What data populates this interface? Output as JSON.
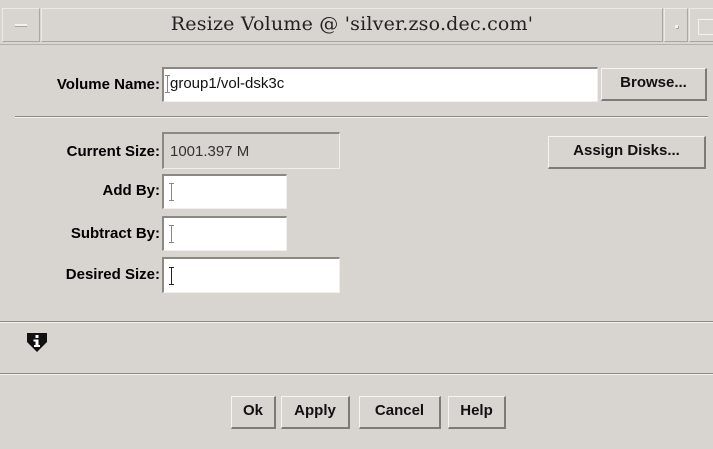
{
  "window": {
    "title": "Resize Volume @ 'silver.zso.dec.com'"
  },
  "volume": {
    "name_label": "Volume Name:",
    "name_value": "group1/vol-dsk3c",
    "browse_label": "Browse..."
  },
  "sizes": {
    "current_label": "Current Size:",
    "current_value": "1001.397 M",
    "assign_label": "Assign Disks...",
    "add_label": "Add By:",
    "add_value": "",
    "subtract_label": "Subtract By:",
    "subtract_value": "",
    "desired_label": "Desired Size:",
    "desired_value": ""
  },
  "status": {
    "icon": "info-icon"
  },
  "buttons": {
    "ok": "Ok",
    "apply": "Apply",
    "cancel": "Cancel",
    "help": "Help"
  }
}
